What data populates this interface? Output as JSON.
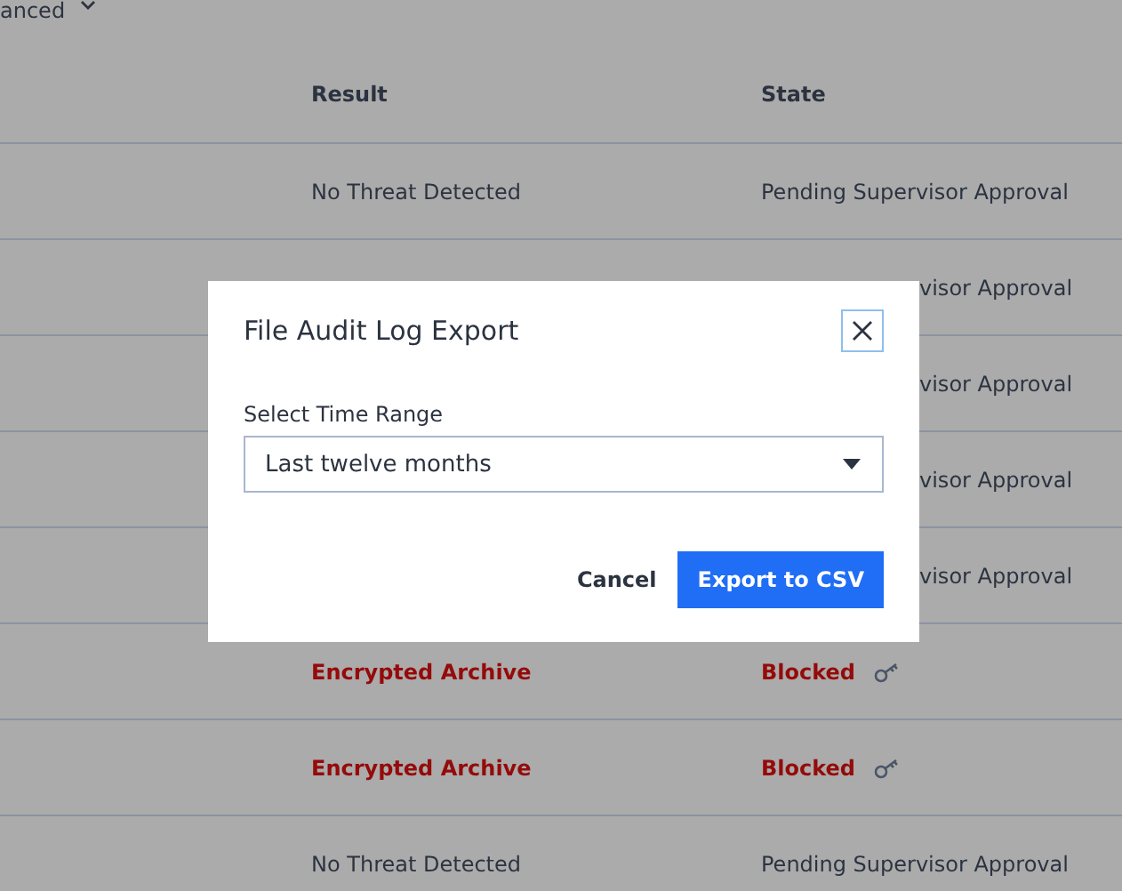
{
  "filter": {
    "label": "anced"
  },
  "table": {
    "columns": [
      "Result",
      "State"
    ],
    "rows": [
      {
        "kind": "normal",
        "result": "No Threat Detected",
        "state": "Pending Supervisor Approval"
      },
      {
        "kind": "covered",
        "state": "visor Approval"
      },
      {
        "kind": "covered",
        "state": "visor Approval"
      },
      {
        "kind": "covered",
        "state": "visor Approval"
      },
      {
        "kind": "covered",
        "state": "visor Approval"
      },
      {
        "kind": "blocked",
        "result": "Encrypted Archive",
        "state": "Blocked"
      },
      {
        "kind": "blocked",
        "result": "Encrypted Archive",
        "state": "Blocked"
      },
      {
        "kind": "normal",
        "result": "No Threat Detected",
        "state": "Pending Supervisor Approval"
      }
    ]
  },
  "dialog": {
    "title": "File Audit Log Export",
    "field_label": "Select Time Range",
    "select_value": "Last twelve months",
    "buttons": [
      "Cancel",
      "Export to CSV"
    ]
  }
}
